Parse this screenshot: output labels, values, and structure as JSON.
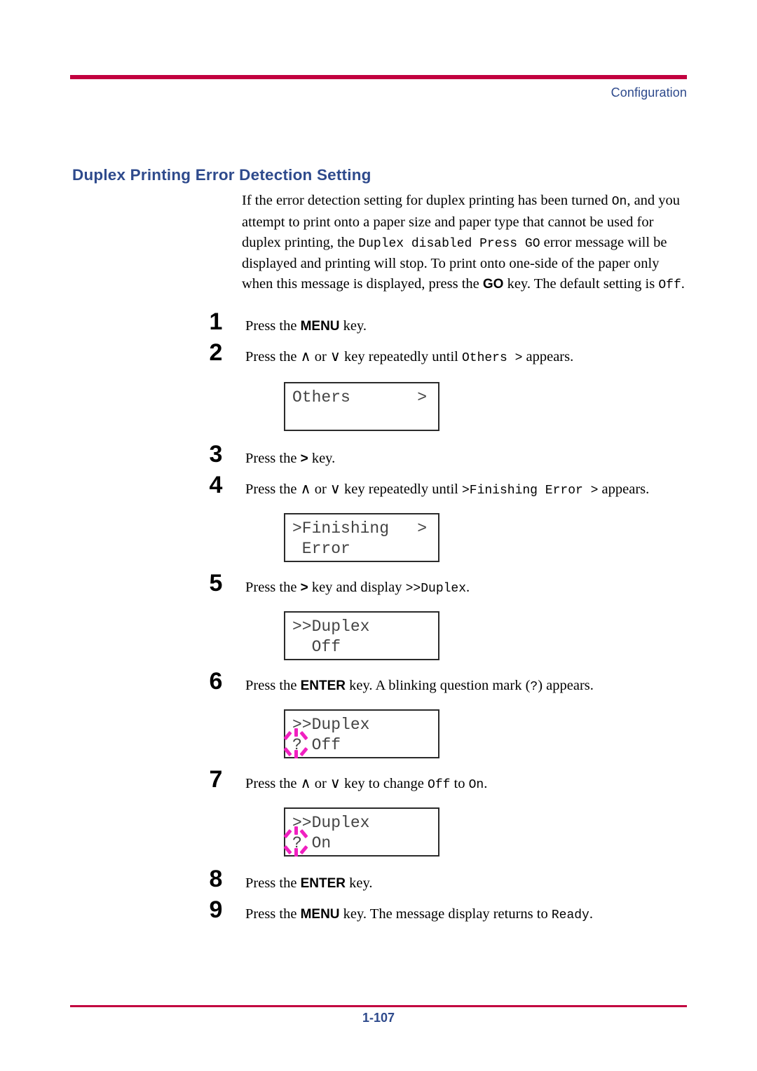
{
  "header": {
    "label": "Configuration",
    "rule_color": "#C2003F",
    "text_color": "#2E4A8C"
  },
  "section": {
    "title": "Duplex Printing Error Detection Setting",
    "title_color": "#2E4A8C"
  },
  "intro": {
    "part1": "If the error detection setting for duplex printing has been turned ",
    "mono1": "On",
    "part2": ", and you attempt to print onto a paper size and paper type that cannot be used for duplex printing, the ",
    "mono2": "Duplex disabled Press GO",
    "part3": " error message will be displayed and printing will stop. To print onto one-side of the paper only when this message is displayed, press the ",
    "kbd1": "GO",
    "part4": " key. The default setting is ",
    "mono3": "Off",
    "part5": "."
  },
  "steps": [
    {
      "num": "1",
      "text_a": "Press the ",
      "kbd": "MENU",
      "text_b": " key."
    },
    {
      "num": "2",
      "text_a": "Press the ∧ or ∨ key repeatedly until ",
      "mono": "Others >",
      "text_b": " appears."
    },
    {
      "num": "3",
      "text_a": "Press the ",
      "kbd": ">",
      "text_b": " key."
    },
    {
      "num": "4",
      "text_a": "Press the ∧ or ∨ key repeatedly until ",
      "mono": ">Finishing Error >",
      "text_b": " appears."
    },
    {
      "num": "5",
      "text_a": "Press the ",
      "kbd": ">",
      "text_b": " key and display ",
      "mono": ">>Duplex",
      "text_c": "."
    },
    {
      "num": "6",
      "text_a": "Press the ",
      "kbd": "ENTER",
      "text_b": " key. A blinking question mark (",
      "mono": "?",
      "text_c": ") appears."
    },
    {
      "num": "7",
      "text_a": "Press the ∧ or ∨ key to change ",
      "mono": "Off",
      "text_b": " to ",
      "mono2": "On",
      "text_c": "."
    },
    {
      "num": "8",
      "text_a": "Press the ",
      "kbd": "ENTER",
      "text_b": " key."
    },
    {
      "num": "9",
      "text_a": "Press the ",
      "kbd": "MENU",
      "text_b": " key. The message display returns to ",
      "mono": "Ready",
      "text_c": "."
    }
  ],
  "displays": [
    {
      "id": "others",
      "line1_left": "Others",
      "line1_right": ">",
      "line2": ""
    },
    {
      "id": "finishing-error",
      "line1_left": ">Finishing",
      "line1_right": ">",
      "line2": " Error"
    },
    {
      "id": "duplex-off",
      "line1_left": ">>Duplex",
      "line1_right": "",
      "line2": "  Off"
    },
    {
      "id": "duplex-off-blinking",
      "line1_left": ">>Duplex",
      "line1_right": "",
      "line2_marker": "?",
      "line2": " Off",
      "blink_color": "#F020C0"
    },
    {
      "id": "duplex-on-blinking",
      "line1_left": ">>Duplex",
      "line1_right": "",
      "line2_marker": "?",
      "line2": " On",
      "blink_color": "#F020C0"
    }
  ],
  "footer": {
    "page": "1-107",
    "rule_color": "#C2003F",
    "text_color": "#2E4A8C"
  }
}
